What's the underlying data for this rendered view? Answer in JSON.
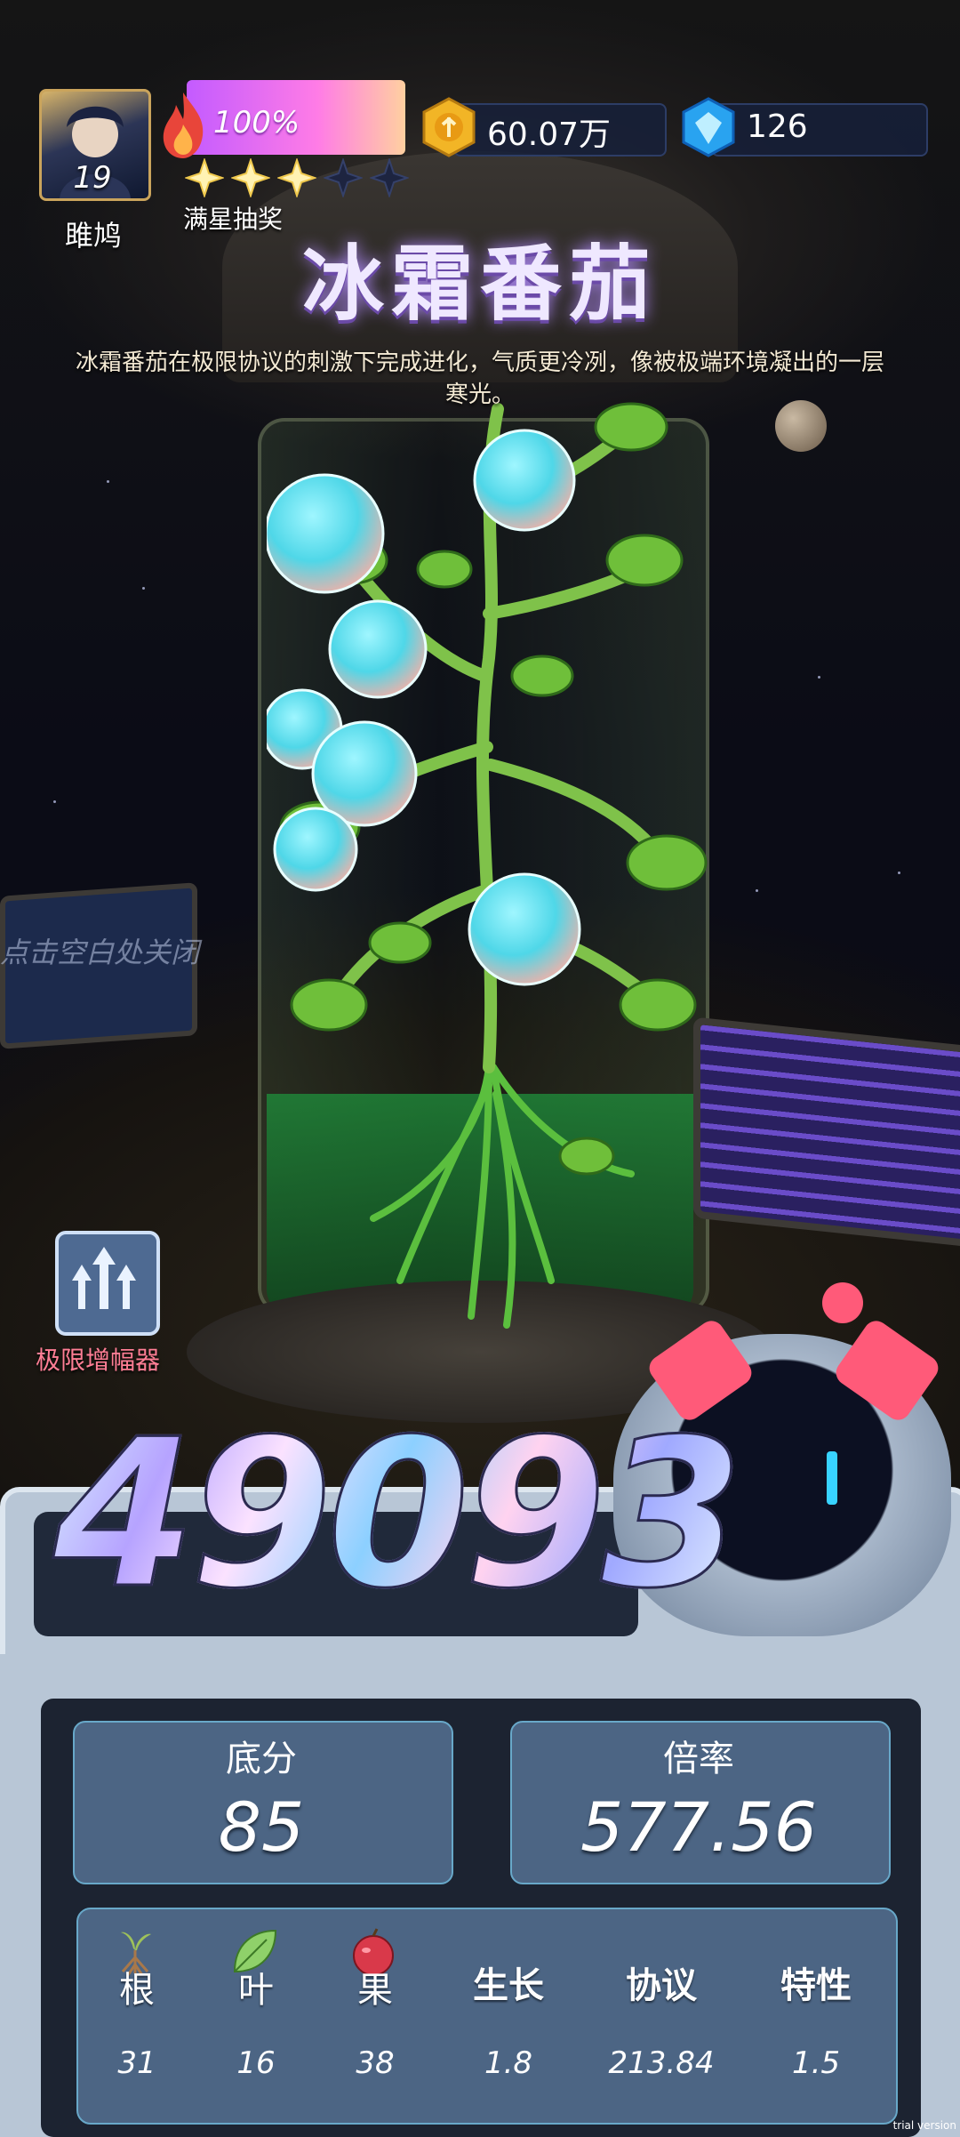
{
  "player": {
    "level": "19",
    "nickname": "雎鸠",
    "energy_percent": "100%",
    "energy_fraction": 1.0,
    "stars_filled": 3,
    "stars_total": 5,
    "stars_label": "满星抽奖"
  },
  "resources": {
    "gold": "60.07万",
    "gems": "126"
  },
  "plant": {
    "name": "冰霜番茄",
    "description": "冰霜番茄在极限协议的刺激下完成进化，气质更冷冽，像被极端环境凝出的一层寒光。"
  },
  "hints": {
    "close": "点击空白处关闭",
    "amplifier": "极限增幅器"
  },
  "score": {
    "total": "49093",
    "base_label": "底分",
    "base_value": "85",
    "multiplier_label": "倍率",
    "multiplier_value": "577.56"
  },
  "attributes": [
    {
      "label": "根",
      "value": "31",
      "icon": "root-icon"
    },
    {
      "label": "叶",
      "value": "16",
      "icon": "leaf-icon"
    },
    {
      "label": "果",
      "value": "38",
      "icon": "fruit-icon"
    },
    {
      "label": "生长",
      "value": "1.8"
    },
    {
      "label": "协议",
      "value": "213.84"
    },
    {
      "label": "特性",
      "value": "1.5"
    }
  ],
  "watermark": "trial version",
  "colors": {
    "energy_start": "#c35bff",
    "energy_end": "#ffd0a0",
    "card_bg": "#4c6584",
    "card_border": "#68a8c9",
    "accent_pink": "#ff5a79",
    "fruit_cyan": "#5ae4f0"
  }
}
